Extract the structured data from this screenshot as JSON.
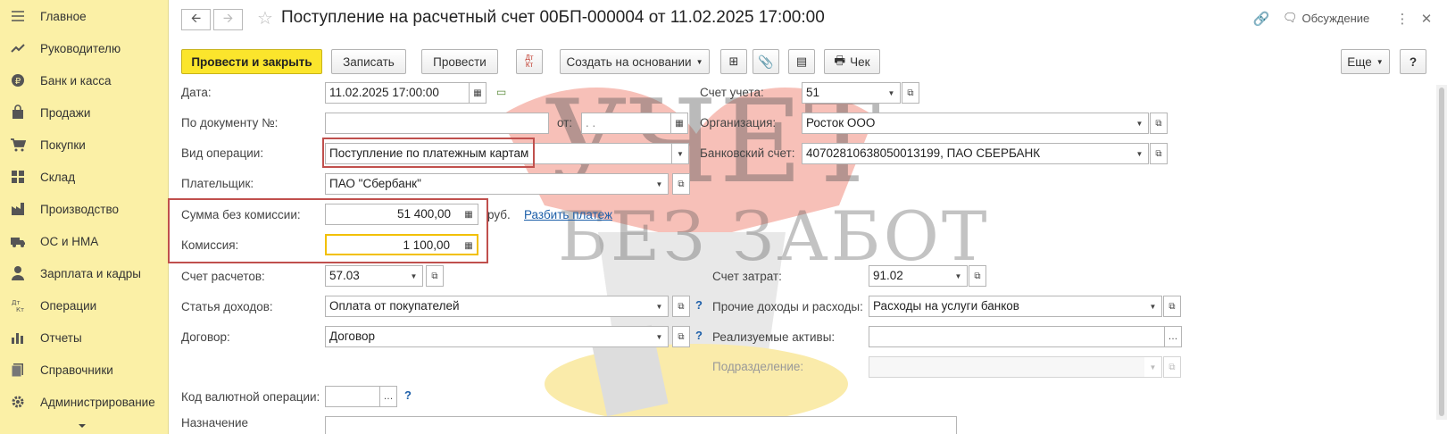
{
  "sidebar": {
    "items": [
      {
        "label": "Главное",
        "icon": "menu-icon"
      },
      {
        "label": "Руководителю",
        "icon": "trend-icon"
      },
      {
        "label": "Банк и касса",
        "icon": "coin-icon"
      },
      {
        "label": "Продажи",
        "icon": "bag-icon"
      },
      {
        "label": "Покупки",
        "icon": "cart-icon"
      },
      {
        "label": "Склад",
        "icon": "grid-icon"
      },
      {
        "label": "Производство",
        "icon": "factory-icon"
      },
      {
        "label": "ОС и НМА",
        "icon": "truck-icon"
      },
      {
        "label": "Зарплата и кадры",
        "icon": "person-icon"
      },
      {
        "label": "Операции",
        "icon": "dt-kt-icon"
      },
      {
        "label": "Отчеты",
        "icon": "bar-chart-icon"
      },
      {
        "label": "Справочники",
        "icon": "books-icon"
      },
      {
        "label": "Администрирование",
        "icon": "gear-icon"
      }
    ]
  },
  "header": {
    "title": "Поступление на расчетный счет 00БП-000004 от 11.02.2025 17:00:00",
    "discussion": "Обсуждение"
  },
  "toolbar": {
    "post_close": "Провести и закрыть",
    "save": "Записать",
    "post": "Провести",
    "dtkt": "Дт\nКт",
    "create_based": "Создать на основании",
    "check": "Чек",
    "more": "Еще",
    "help": "?"
  },
  "form": {
    "date_label": "Дата:",
    "date_value": "11.02.2025 17:00:00",
    "doc_no_label": "По документу №:",
    "doc_no_value": "",
    "from_label": "от:",
    "from_value": ". .",
    "op_type_label": "Вид операции:",
    "op_type_value": "Поступление по платежным картам",
    "payer_label": "Плательщик:",
    "payer_value": "ПАО \"Сбербанк\"",
    "sum_label": "Сумма без комиссии:",
    "sum_value": "51 400,00",
    "currency": "руб.",
    "split_link": "Разбить платеж",
    "commission_label": "Комиссия:",
    "commission_value": "1 100,00",
    "settle_acc_label": "Счет расчетов:",
    "settle_acc_value": "57.03",
    "income_item_label": "Статья доходов:",
    "income_item_value": "Оплата от покупателей",
    "contract_label": "Договор:",
    "contract_value": "Договор",
    "currency_op_label": "Код валютной операции:",
    "currency_op_value": "",
    "purpose_label": "Назначение",
    "account_label": "Счет учета:",
    "account_value": "51",
    "org_label": "Организация:",
    "org_value": "Росток ООО",
    "bank_acc_label": "Банковский счет:",
    "bank_acc_value": "40702810638050013199, ПАО СБЕРБАНК",
    "cost_acc_label": "Счет затрат:",
    "cost_acc_value": "91.02",
    "other_label": "Прочие доходы и расходы:",
    "other_value": "Расходы на услуги банков",
    "assets_label": "Реализуемые активы:",
    "assets_value": "",
    "division_label": "Подразделение:",
    "division_value": ""
  },
  "watermark": {
    "line1": "УЧЕТ",
    "line2": "БЕЗ ЗАБОТ"
  }
}
